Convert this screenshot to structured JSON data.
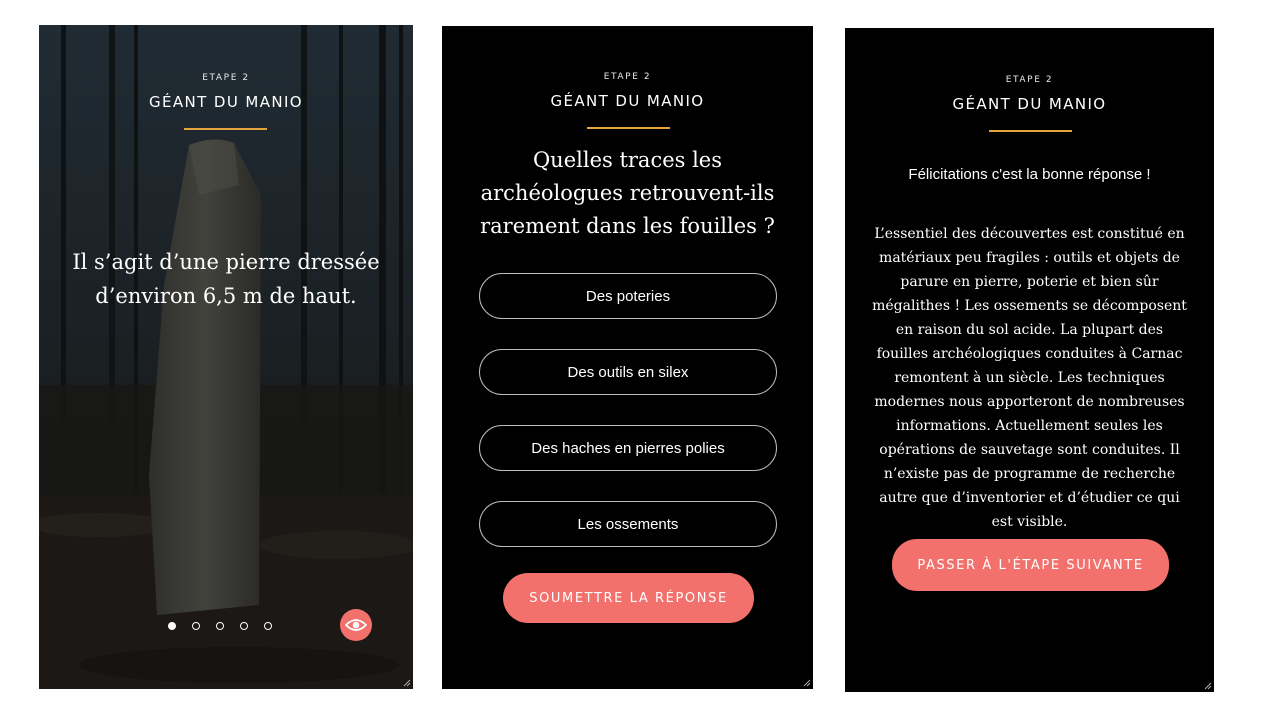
{
  "panels": {
    "intro": {
      "step": "ETAPE 2",
      "title": "GÉANT DU MANIO",
      "text": "Il s’agit d’une pierre dressée d’environ 6,5 m de haut.",
      "pagination": {
        "total": 5,
        "active_index": 0
      },
      "eye_icon": "eye-icon",
      "accent": "#e8a43c",
      "button_color": "#f3716c"
    },
    "quiz": {
      "step": "ETAPE 2",
      "title": "GÉANT DU MANIO",
      "question": "Quelles traces les archéologues retrouvent-ils rarement dans les fouilles ?",
      "options": [
        "Des poteries",
        "Des outils en silex",
        "Des haches en pierres polies",
        "Les ossements"
      ],
      "submit_label": "SOUMETTRE LA RÉPONSE"
    },
    "result": {
      "step": "ETAPE 2",
      "title": "GÉANT DU MANIO",
      "congrats": "Félicitations c'est la bonne réponse !",
      "explanation": "L’essentiel des découvertes est constitué en matériaux peu fragiles : outils et objets de parure en pierre, poterie et bien sûr mégalithes ! Les ossements se décomposent en raison du sol acide. La plupart des fouilles archéologiques conduites à Carnac remontent à un siècle. Les techniques modernes nous apporteront de nombreuses informations. Actuellement seules les opérations de sauvetage sont conduites. Il n’existe pas de programme de recherche autre que d’inventorier et d’étudier ce qui est visible.",
      "next_label": "PASSER À L'ÉTAPE SUIVANTE"
    }
  }
}
